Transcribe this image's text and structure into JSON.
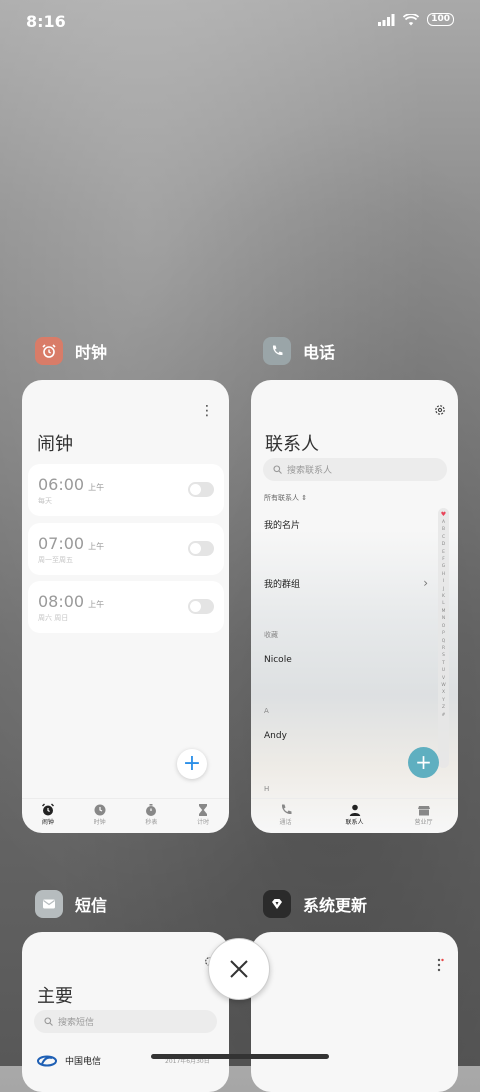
{
  "status_bar": {
    "time": "8:16",
    "battery": "100"
  },
  "apps": {
    "clock": {
      "name": "时钟",
      "title": "闹钟",
      "alarms": [
        {
          "time": "06:00",
          "ampm": "上午",
          "sub": "每天"
        },
        {
          "time": "07:00",
          "ampm": "上午",
          "sub": "周一至周五"
        },
        {
          "time": "08:00",
          "ampm": "上午",
          "sub": "周六 周日"
        }
      ],
      "nav": [
        {
          "icon": "alarm-icon",
          "label": "闹钟",
          "active": true
        },
        {
          "icon": "clock-icon",
          "label": "时钟",
          "active": false
        },
        {
          "icon": "stopwatch-icon",
          "label": "秒表",
          "active": false
        },
        {
          "icon": "hourglass-icon",
          "label": "计时",
          "active": false
        }
      ]
    },
    "phone": {
      "name": "电话",
      "title": "联系人",
      "search_placeholder": "搜索联系人",
      "filter": "所有联系人",
      "my_card": "我的名片",
      "my_groups": "我的群组",
      "favorites_label": "收藏",
      "favorite_contact": "Nicole",
      "section_a": "A",
      "contact_a": "Andy",
      "section_h": "H",
      "index_letters": [
        "A",
        "B",
        "C",
        "D",
        "E",
        "F",
        "G",
        "H",
        "I",
        "J",
        "K",
        "L",
        "M",
        "N",
        "O",
        "P",
        "Q",
        "R",
        "S",
        "T",
        "U",
        "V",
        "W",
        "X",
        "Y",
        "Z",
        "#"
      ],
      "nav": [
        {
          "icon": "phone-icon",
          "label": "通话",
          "active": false
        },
        {
          "icon": "person-icon",
          "label": "联系人",
          "active": true
        },
        {
          "icon": "store-icon",
          "label": "营业厅",
          "active": false
        }
      ]
    },
    "sms": {
      "name": "短信",
      "title": "主要",
      "search_placeholder": "搜索短信",
      "first_sender": "中国电信",
      "first_date": "2017年6月30日"
    },
    "update": {
      "name": "系统更新"
    }
  },
  "colors": {
    "clock_icon": "#d97c68",
    "phone_icon": "#9aa5a8",
    "sms_icon": "#b6bcbe",
    "update_icon": "#2b2b2b",
    "accent_blue": "#2b8fe8",
    "accent_teal": "#5fafc0"
  }
}
